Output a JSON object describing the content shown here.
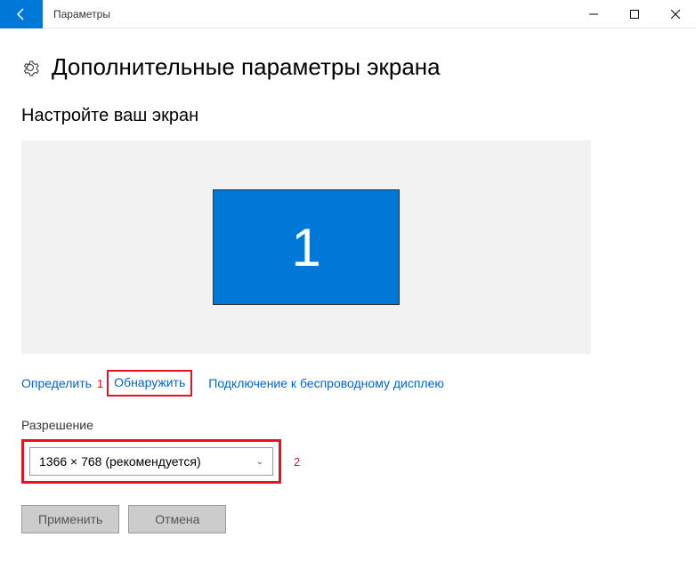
{
  "titlebar": {
    "title": "Параметры"
  },
  "page": {
    "heading": "Дополнительные параметры экрана",
    "section_title": "Настройте ваш экран"
  },
  "monitor": {
    "number": "1"
  },
  "links": {
    "identify": "Определить",
    "detect": "Обнаружить",
    "wireless": "Подключение к беспроводному дисплею"
  },
  "annotations": {
    "one": "1",
    "two": "2"
  },
  "resolution": {
    "label": "Разрешение",
    "value": "1366 × 768 (рекомендуется)"
  },
  "buttons": {
    "apply": "Применить",
    "cancel": "Отмена"
  }
}
